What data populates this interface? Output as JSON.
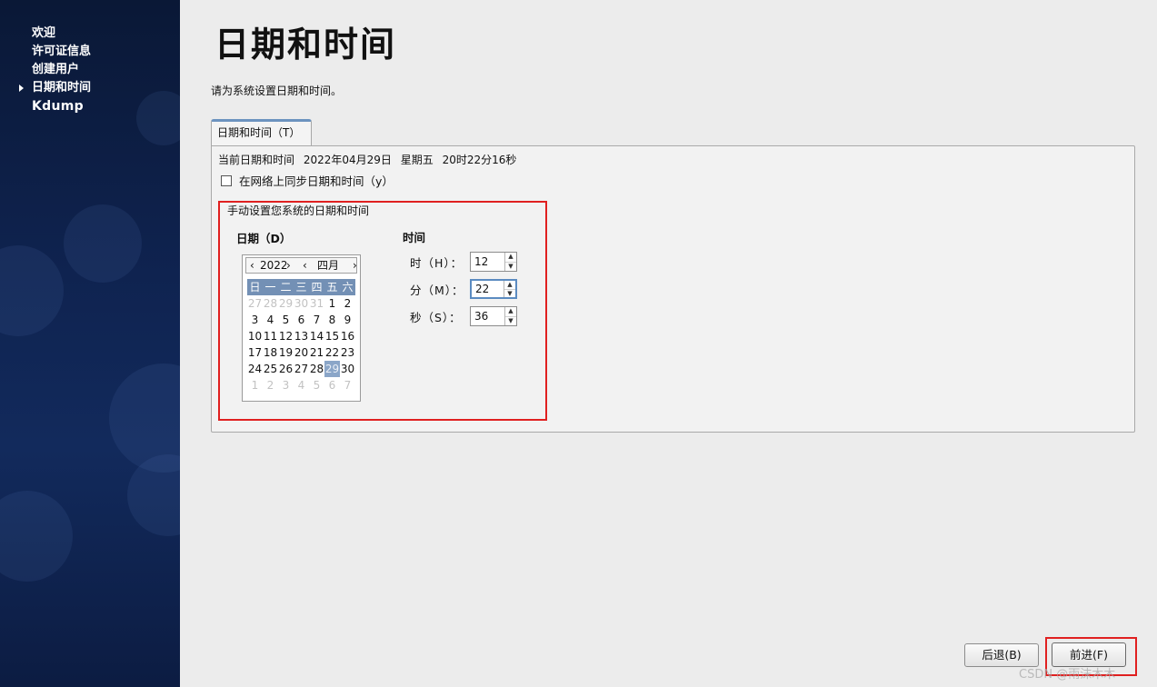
{
  "sidebar": {
    "items": [
      {
        "label": "欢迎",
        "active": false
      },
      {
        "label": "许可证信息",
        "active": false
      },
      {
        "label": "创建用户",
        "active": false
      },
      {
        "label": "日期和时间",
        "active": true
      },
      {
        "label": "Kdump",
        "active": false
      }
    ]
  },
  "main": {
    "title": "日期和时间",
    "subtitle": "请为系统设置日期和时间。",
    "tab_label": "日期和时间（T）",
    "current_label": "当前日期和时间",
    "current_date": "2022年04月29日",
    "current_weekday": "星期五",
    "current_time": "20时22分16秒",
    "sync_label": "在网络上同步日期和时间（y）",
    "sync_checked": false,
    "manual_legend": "手动设置您系统的日期和时间",
    "date_label": "日期（D）",
    "time_label": "时间"
  },
  "calendar": {
    "year": "2022",
    "month": "四月",
    "prev_icon": "‹",
    "next_icon": "›",
    "weekdays": [
      "日",
      "一",
      "二",
      "三",
      "四",
      "五",
      "六"
    ],
    "weeks": [
      [
        "27",
        "28",
        "29",
        "30",
        "31",
        "1",
        "2"
      ],
      [
        "3",
        "4",
        "5",
        "6",
        "7",
        "8",
        "9"
      ],
      [
        "10",
        "11",
        "12",
        "13",
        "14",
        "15",
        "16"
      ],
      [
        "17",
        "18",
        "19",
        "20",
        "21",
        "22",
        "23"
      ],
      [
        "24",
        "25",
        "26",
        "27",
        "28",
        "29",
        "30"
      ],
      [
        "1",
        "2",
        "3",
        "4",
        "5",
        "6",
        "7"
      ]
    ],
    "selected_day": "29"
  },
  "time": {
    "hour_label": "时（H）：",
    "hour_value": "12",
    "minute_label": "分（M）：",
    "minute_value": "22",
    "second_label": "秒（S）：",
    "second_value": "36",
    "up_icon": "▲",
    "down_icon": "▼"
  },
  "buttons": {
    "back": "后退(B)",
    "forward": "前进(F)"
  },
  "watermark": "CSDN @雨沫木木",
  "colors": {
    "highlight_box": "#e02020",
    "calendar_header": "#7390b5",
    "tab_accent": "#6c93bf"
  }
}
